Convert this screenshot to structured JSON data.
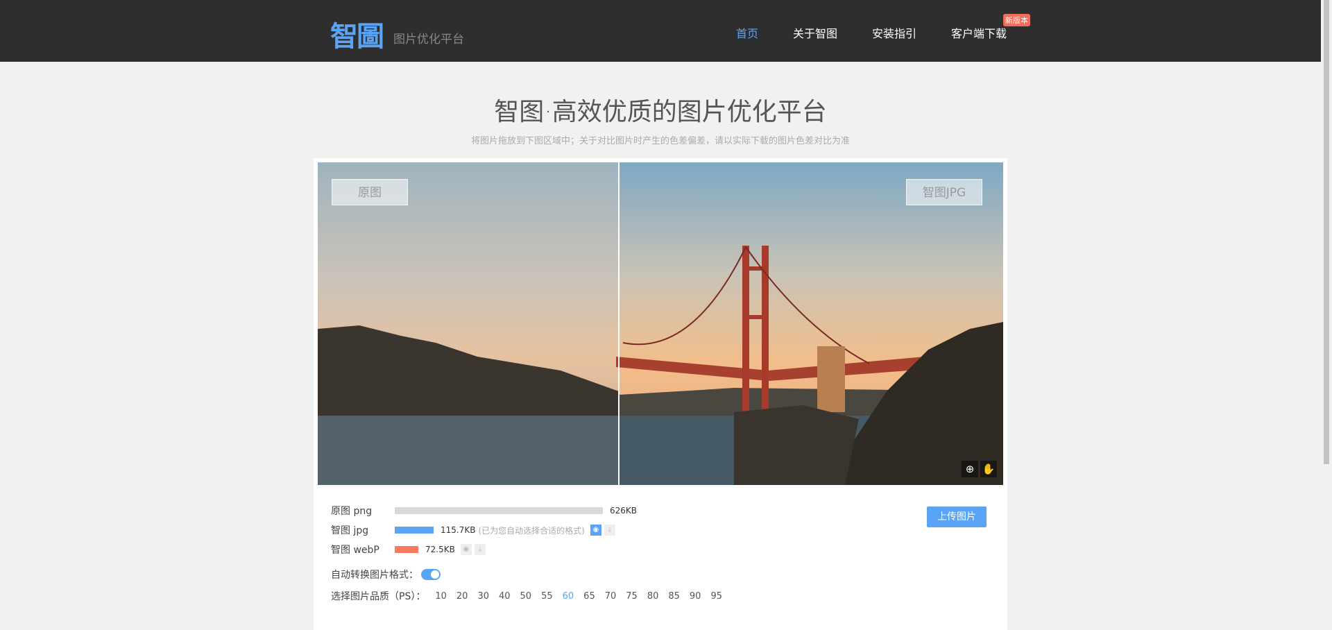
{
  "header": {
    "logo": "智圖",
    "logo_sub": "图片优化平台",
    "nav": [
      {
        "label": "首页",
        "active": true
      },
      {
        "label": "关于智图"
      },
      {
        "label": "安装指引"
      },
      {
        "label": "客户端下载"
      }
    ],
    "badge": "新版本"
  },
  "hero": {
    "title": "智图·高效优质的图片优化平台",
    "subtitle": "将图片拖放到下图区域中；关于对比图片时产生的色差偏差，请以实际下载的图片色差对比为准"
  },
  "viewer": {
    "left_label": "原图",
    "right_label": "智图JPG",
    "icons": [
      "zoom-in-icon",
      "color-picker-icon"
    ]
  },
  "files": [
    {
      "label": "原图 png",
      "size": "626KB",
      "percent": 100,
      "color": "#d9d9d9"
    },
    {
      "label": "智图 jpg",
      "size": "115.7KB",
      "note": "(已为您自动选择合适的格式)",
      "percent": 18.5,
      "color": "#5aa4f6"
    },
    {
      "label": "智图 webP",
      "size": "72.5KB",
      "percent": 11.6,
      "color": "#f97a5f"
    }
  ],
  "auto_convert": {
    "label": "自动转换图片格式：",
    "on": true
  },
  "quality": {
    "label": "选择图片品质（PS）：",
    "options": [
      "10",
      "20",
      "30",
      "40",
      "50",
      "55",
      "60",
      "65",
      "70",
      "75",
      "80",
      "85",
      "90",
      "95"
    ],
    "selected": "60"
  },
  "upload_label": "上传图片"
}
